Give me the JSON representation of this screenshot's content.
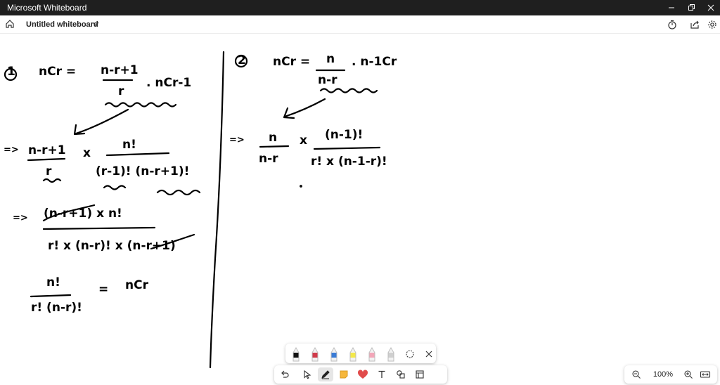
{
  "window": {
    "title": "Microsoft Whiteboard",
    "buttons": [
      "minimize",
      "restore",
      "close"
    ]
  },
  "appbar": {
    "home_icon": "home-icon",
    "board_name": "Untitled whiteboard",
    "right_icons": [
      "timer-icon",
      "share-icon",
      "settings-icon"
    ]
  },
  "canvas": {
    "left_derivation": {
      "label": "1",
      "lhs": "nCr =",
      "rhs_num": "n-r+1",
      "rhs_den": "r",
      "rhs_tail": ". nCr-1",
      "step1_prefix": "=>",
      "step1_frac_num": "n-r+1",
      "step1_frac_den": "r",
      "step1_times": "x",
      "step1_num": "n!",
      "step1_den": "(r-1)! (n-r+1)!",
      "step2_prefix": "=>",
      "step2_num": "(n-r+1) x n!",
      "step2_den": "r! x (n-r)! x (n-r+1)",
      "result_num": "n!",
      "result_den": "r! (n-r)!",
      "result_eq": "=",
      "result_rhs": "nCr"
    },
    "right_derivation": {
      "label": "2",
      "lhs": "nCr =",
      "rhs_num": "n",
      "rhs_den": "n-r",
      "rhs_tail": ". n-1Cr",
      "step1_prefix": "=>",
      "step1_frac_num": "n",
      "step1_frac_den": "n-r",
      "step1_times": "x",
      "step1_num": "(n-1)!",
      "step1_den": "r! x (n-1-r)!"
    }
  },
  "pen_tray": {
    "pens": [
      {
        "name": "black-pen",
        "color": "#111111"
      },
      {
        "name": "red-pen",
        "color": "#d03a4a"
      },
      {
        "name": "blue-pen",
        "color": "#3a7bd5"
      },
      {
        "name": "yellow-highlighter",
        "color": "#f3e84a"
      },
      {
        "name": "pink-highlighter",
        "color": "#f2a6b8"
      },
      {
        "name": "ruler",
        "color": "#cfcfcf"
      }
    ]
  },
  "toolbar": {
    "tools": [
      "undo-icon",
      "select-icon",
      "pen-icon",
      "sticky-note-icon",
      "reaction-icon",
      "text-icon",
      "shapes-icon",
      "templates-icon"
    ]
  },
  "zoom": {
    "value": "100%"
  }
}
